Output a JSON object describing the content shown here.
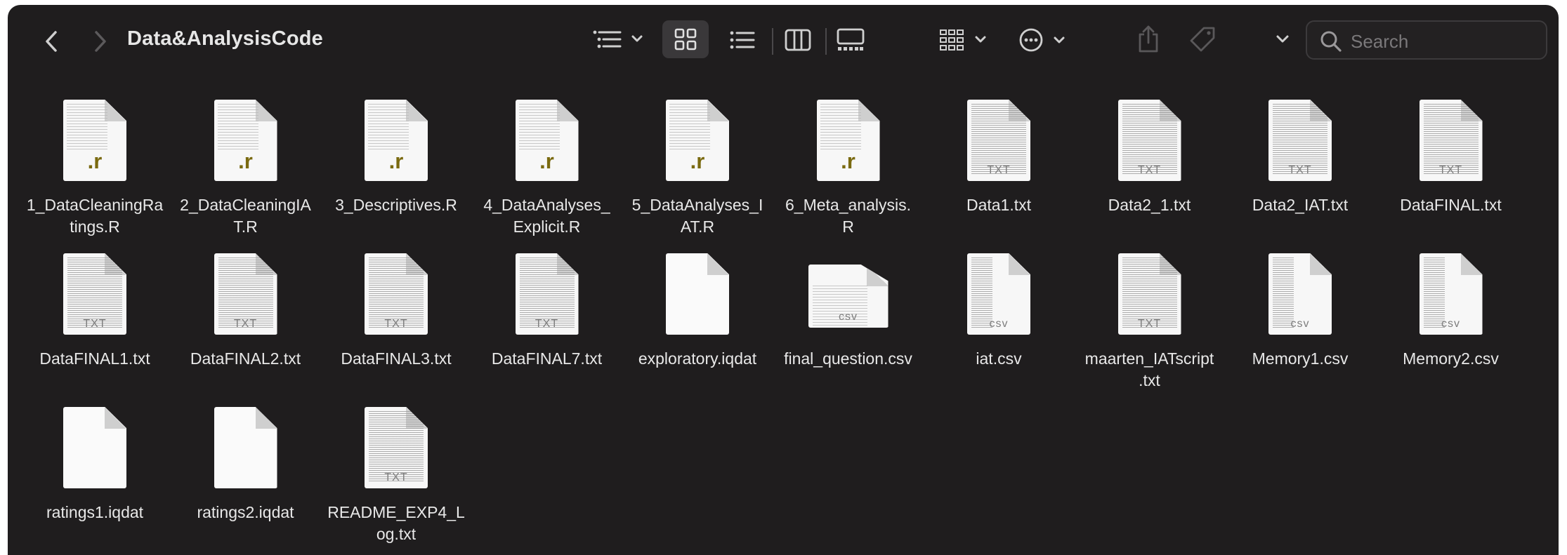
{
  "window": {
    "title": "Data&AnalysisCode"
  },
  "search": {
    "placeholder": "Search"
  },
  "files": [
    {
      "line1": "1_DataCleaningRa",
      "line2": "tings.R",
      "type": "r"
    },
    {
      "line1": "2_DataCleaningIA",
      "line2": "T.R",
      "type": "r"
    },
    {
      "line1": "3_Descriptives.R",
      "line2": "",
      "type": "r"
    },
    {
      "line1": "4_DataAnalyses_",
      "line2": "Explicit.R",
      "type": "r"
    },
    {
      "line1": "5_DataAnalyses_I",
      "line2": "AT.R",
      "type": "r"
    },
    {
      "line1": "6_Meta_analysis.",
      "line2": "R",
      "type": "r"
    },
    {
      "line1": "Data1.txt",
      "line2": "",
      "type": "txt"
    },
    {
      "line1": "Data2_1.txt",
      "line2": "",
      "type": "txt"
    },
    {
      "line1": "Data2_IAT.txt",
      "line2": "",
      "type": "txt"
    },
    {
      "line1": "DataFINAL.txt",
      "line2": "",
      "type": "txt"
    },
    {
      "line1": "DataFINAL1.txt",
      "line2": "",
      "type": "txt"
    },
    {
      "line1": "DataFINAL2.txt",
      "line2": "",
      "type": "txt"
    },
    {
      "line1": "DataFINAL3.txt",
      "line2": "",
      "type": "txt"
    },
    {
      "line1": "DataFINAL7.txt",
      "line2": "",
      "type": "txt"
    },
    {
      "line1": "exploratory.iqdat",
      "line2": "",
      "type": "blank"
    },
    {
      "line1": "final_question.csv",
      "line2": "",
      "type": "csv-wide"
    },
    {
      "line1": "iat.csv",
      "line2": "",
      "type": "csv"
    },
    {
      "line1": "maarten_IATscript",
      "line2": ".txt",
      "type": "txt"
    },
    {
      "line1": "Memory1.csv",
      "line2": "",
      "type": "csv"
    },
    {
      "line1": "Memory2.csv",
      "line2": "",
      "type": "csv"
    },
    {
      "line1": "ratings1.iqdat",
      "line2": "",
      "type": "blank"
    },
    {
      "line1": "ratings2.iqdat",
      "line2": "",
      "type": "blank"
    },
    {
      "line1": "README_EXP4_L",
      "line2": "og.txt",
      "type": "txt"
    }
  ],
  "badges": {
    "r": ".r",
    "txt": "TXT",
    "csv": "csv"
  },
  "colors": {
    "background": "#1f1d1e",
    "text": "#e8e8e8",
    "r_badge": "#7a6a10"
  },
  "icons": [
    "back-icon",
    "forward-icon",
    "group-by-icon",
    "icon-view-icon",
    "list-view-icon",
    "column-view-icon",
    "gallery-view-icon",
    "arrange-icon",
    "more-actions-icon",
    "share-icon",
    "tag-icon",
    "chevron-down-icon",
    "search-icon"
  ]
}
